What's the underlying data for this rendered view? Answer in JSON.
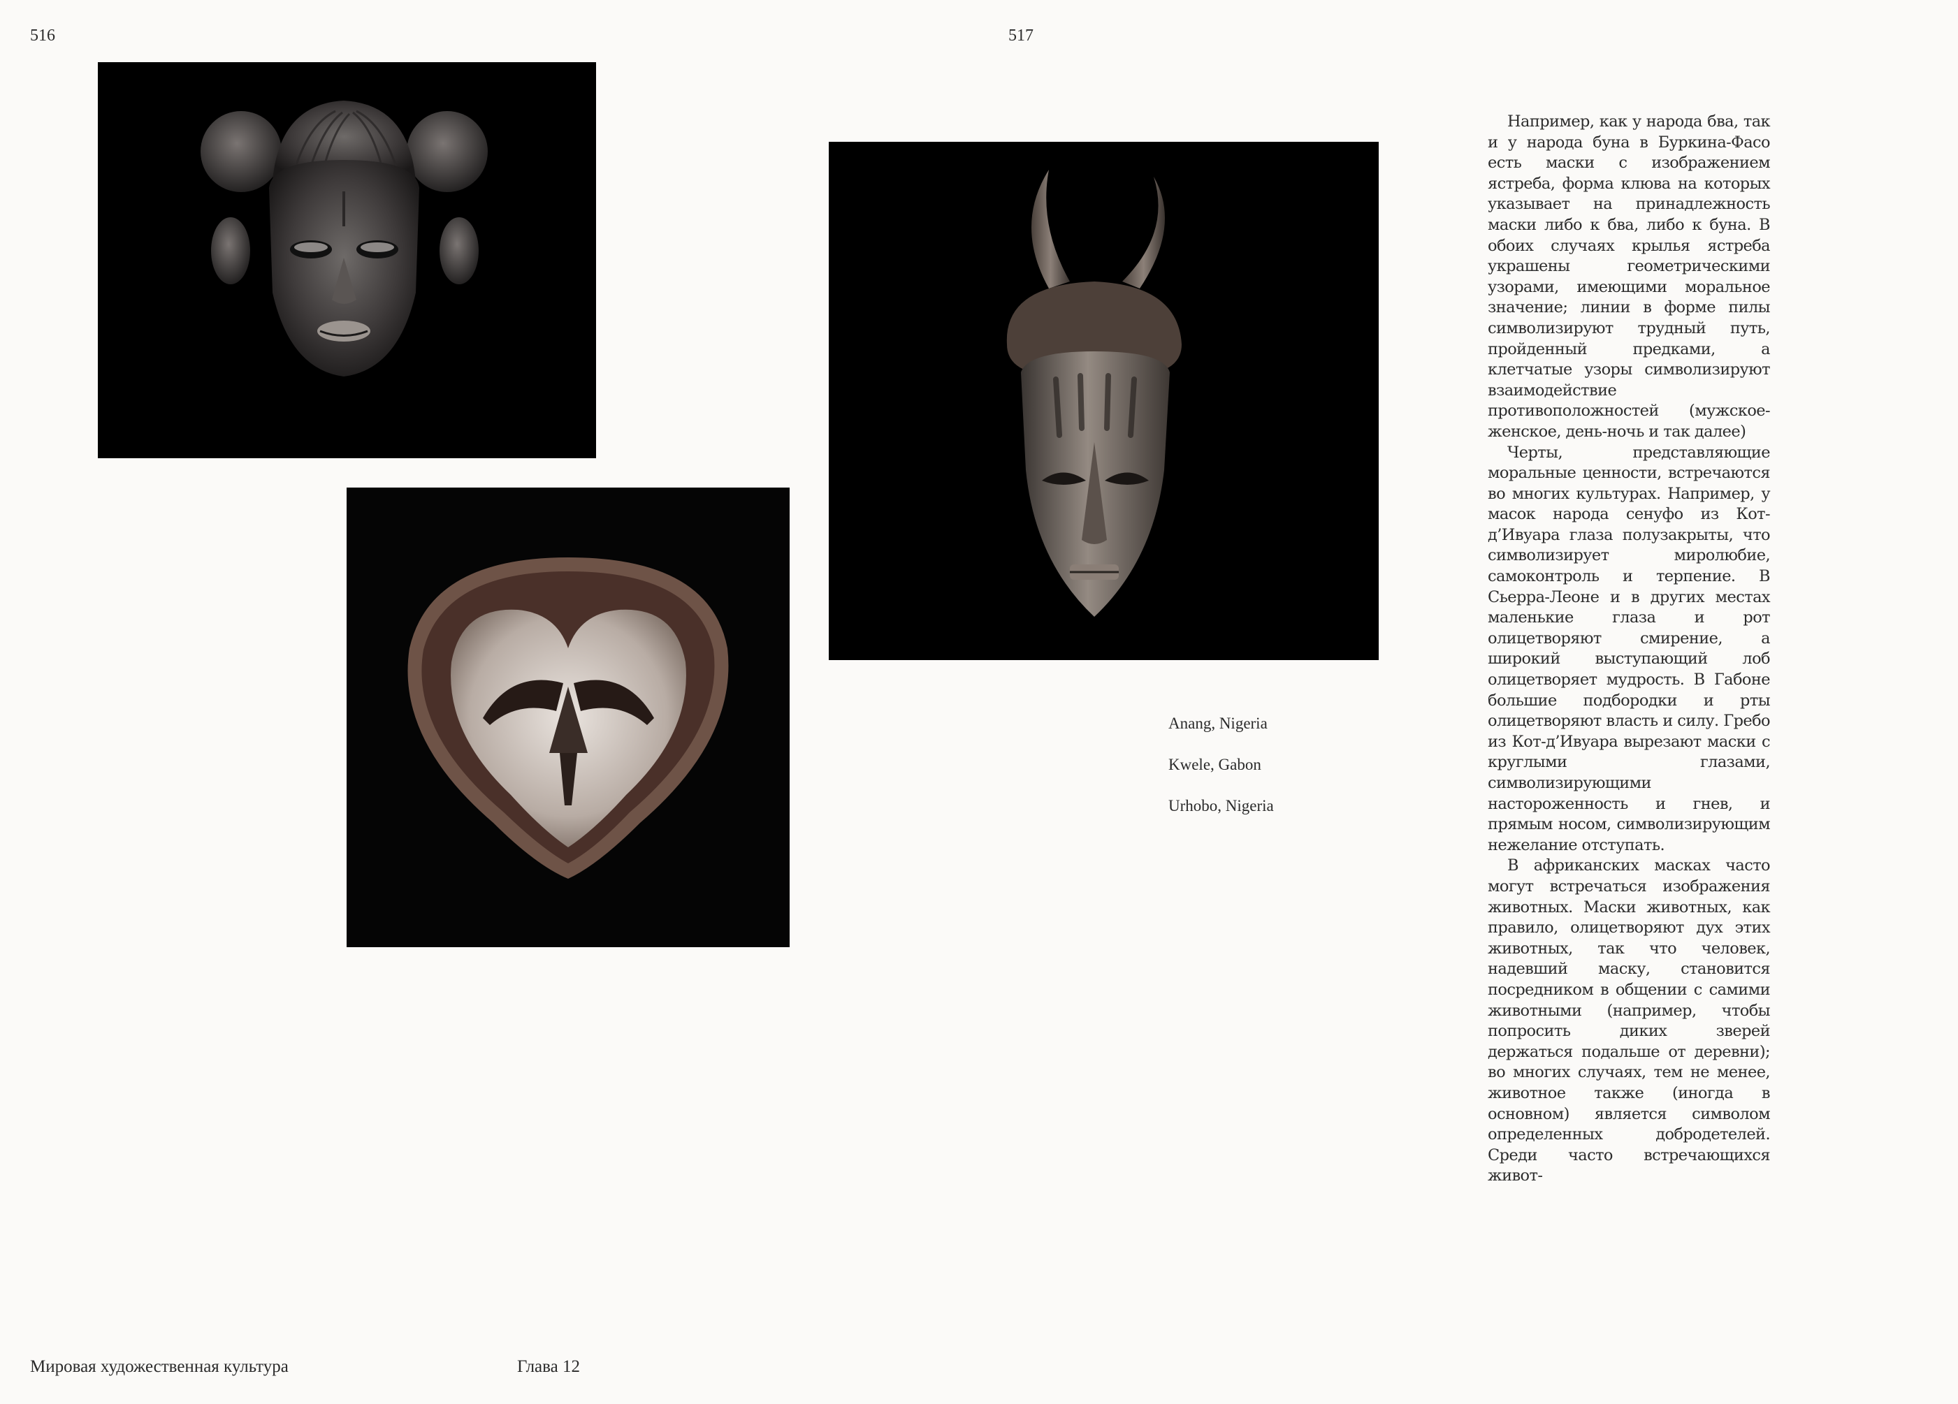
{
  "page_numbers": {
    "left": "516",
    "right": "517"
  },
  "photos": {
    "anang": {
      "alt": "Anang mask",
      "icon": "mask-photo-anang"
    },
    "kwele": {
      "alt": "Kwele mask",
      "icon": "mask-photo-kwele"
    },
    "urhobo": {
      "alt": "Urhobo mask",
      "icon": "mask-photo-urhobo"
    }
  },
  "captions": [
    "Anang, Nigeria",
    "Kwele, Gabon",
    "Urhobo, Nigeria"
  ],
  "body_paragraphs": [
    "Например, как у народа бва, так и у народа буна в Буркина-Фасо есть маски с изображением ястреба, форма клюва на которых указывает на принадлежность маски либо к бва, либо к буна. В обоих случаях крылья ястреба украшены геометрическими узорами, имеющими моральное значение; линии в форме пилы символизируют трудный путь, пройденный предками, а клетчатые узоры символизируют взаимодействие противоположностей (мужское-женское, день-ночь и так далее)",
    "Черты, представляющие моральные ценности, встречаются во многих культурах. Например, у масок народа сенуфо из Кот-д’Ивуара глаза полузакрыты, что символизирует миролюбие, самоконтроль и терпение. В Сьерра-Леоне и в других местах маленькие глаза и рот олицетворяют смирение, а широкий выступающий лоб олицетворяет мудрость. В Габоне большие подбородки и рты олицетворяют власть и силу. Гребо из Кот-д’Ивуара вырезают маски с круглыми глазами, символизирующими настороженность и гнев, и прямым носом, символизирующим нежелание отступать.",
    "В африканских масках часто могут встречаться изображения животных. Маски животных, как правило, олицетворяют дух этих животных, так что человек, надевший маску, становится посредником в общении с самими животными (например, чтобы попросить диких зверей держаться подальше от деревни); во многих случаях, тем не менее, животное также (иногда в основном) является символом определенных добродетелей. Среди часто встречающихся живот-"
  ],
  "footer": {
    "book_title": "Мировая художественная культура",
    "chapter": "Глава 12"
  }
}
